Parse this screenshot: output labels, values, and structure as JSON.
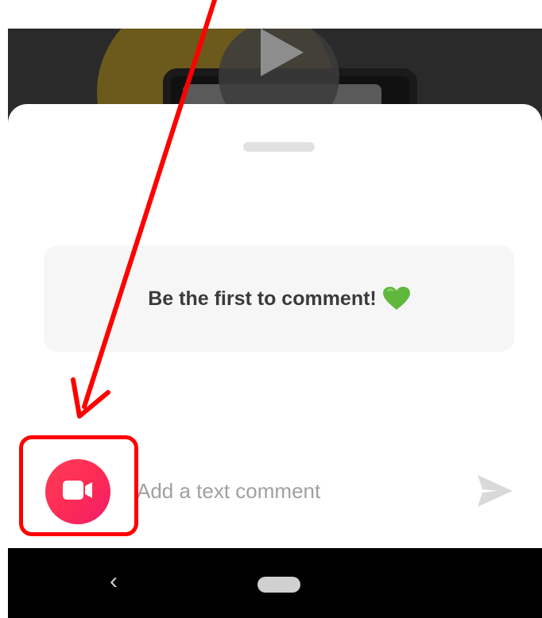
{
  "comments": {
    "empty_message": "Be the first to comment!",
    "heart_icon": "green-heart-icon"
  },
  "composer": {
    "placeholder": "Add a text comment",
    "video_button_icon": "video-camera-icon",
    "send_icon": "send-icon"
  },
  "nav": {
    "back_glyph": "‹"
  },
  "colors": {
    "accent": "#fe2c55",
    "annotation": "#ff0000",
    "heart": "#5fb83c",
    "card_bg": "#f6f6f6",
    "nav_bg": "#000000"
  }
}
